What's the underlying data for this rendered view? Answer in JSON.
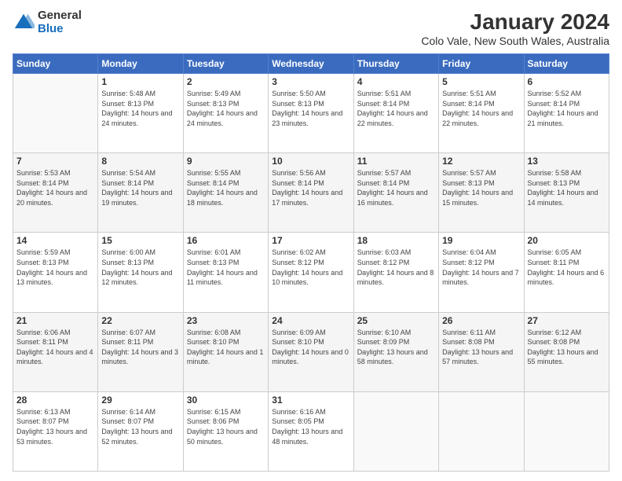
{
  "logo": {
    "general": "General",
    "blue": "Blue"
  },
  "title": "January 2024",
  "subtitle": "Colo Vale, New South Wales, Australia",
  "days_of_week": [
    "Sunday",
    "Monday",
    "Tuesday",
    "Wednesday",
    "Thursday",
    "Friday",
    "Saturday"
  ],
  "weeks": [
    [
      {
        "day": "",
        "empty": true
      },
      {
        "day": "1",
        "sunrise": "5:48 AM",
        "sunset": "8:13 PM",
        "daylight": "14 hours and 24 minutes."
      },
      {
        "day": "2",
        "sunrise": "5:49 AM",
        "sunset": "8:13 PM",
        "daylight": "14 hours and 24 minutes."
      },
      {
        "day": "3",
        "sunrise": "5:50 AM",
        "sunset": "8:13 PM",
        "daylight": "14 hours and 23 minutes."
      },
      {
        "day": "4",
        "sunrise": "5:51 AM",
        "sunset": "8:14 PM",
        "daylight": "14 hours and 22 minutes."
      },
      {
        "day": "5",
        "sunrise": "5:51 AM",
        "sunset": "8:14 PM",
        "daylight": "14 hours and 22 minutes."
      },
      {
        "day": "6",
        "sunrise": "5:52 AM",
        "sunset": "8:14 PM",
        "daylight": "14 hours and 21 minutes."
      }
    ],
    [
      {
        "day": "7",
        "sunrise": "5:53 AM",
        "sunset": "8:14 PM",
        "daylight": "14 hours and 20 minutes."
      },
      {
        "day": "8",
        "sunrise": "5:54 AM",
        "sunset": "8:14 PM",
        "daylight": "14 hours and 19 minutes."
      },
      {
        "day": "9",
        "sunrise": "5:55 AM",
        "sunset": "8:14 PM",
        "daylight": "14 hours and 18 minutes."
      },
      {
        "day": "10",
        "sunrise": "5:56 AM",
        "sunset": "8:14 PM",
        "daylight": "14 hours and 17 minutes."
      },
      {
        "day": "11",
        "sunrise": "5:57 AM",
        "sunset": "8:14 PM",
        "daylight": "14 hours and 16 minutes."
      },
      {
        "day": "12",
        "sunrise": "5:57 AM",
        "sunset": "8:13 PM",
        "daylight": "14 hours and 15 minutes."
      },
      {
        "day": "13",
        "sunrise": "5:58 AM",
        "sunset": "8:13 PM",
        "daylight": "14 hours and 14 minutes."
      }
    ],
    [
      {
        "day": "14",
        "sunrise": "5:59 AM",
        "sunset": "8:13 PM",
        "daylight": "14 hours and 13 minutes."
      },
      {
        "day": "15",
        "sunrise": "6:00 AM",
        "sunset": "8:13 PM",
        "daylight": "14 hours and 12 minutes."
      },
      {
        "day": "16",
        "sunrise": "6:01 AM",
        "sunset": "8:13 PM",
        "daylight": "14 hours and 11 minutes."
      },
      {
        "day": "17",
        "sunrise": "6:02 AM",
        "sunset": "8:12 PM",
        "daylight": "14 hours and 10 minutes."
      },
      {
        "day": "18",
        "sunrise": "6:03 AM",
        "sunset": "8:12 PM",
        "daylight": "14 hours and 8 minutes."
      },
      {
        "day": "19",
        "sunrise": "6:04 AM",
        "sunset": "8:12 PM",
        "daylight": "14 hours and 7 minutes."
      },
      {
        "day": "20",
        "sunrise": "6:05 AM",
        "sunset": "8:11 PM",
        "daylight": "14 hours and 6 minutes."
      }
    ],
    [
      {
        "day": "21",
        "sunrise": "6:06 AM",
        "sunset": "8:11 PM",
        "daylight": "14 hours and 4 minutes."
      },
      {
        "day": "22",
        "sunrise": "6:07 AM",
        "sunset": "8:11 PM",
        "daylight": "14 hours and 3 minutes."
      },
      {
        "day": "23",
        "sunrise": "6:08 AM",
        "sunset": "8:10 PM",
        "daylight": "14 hours and 1 minute."
      },
      {
        "day": "24",
        "sunrise": "6:09 AM",
        "sunset": "8:10 PM",
        "daylight": "14 hours and 0 minutes."
      },
      {
        "day": "25",
        "sunrise": "6:10 AM",
        "sunset": "8:09 PM",
        "daylight": "13 hours and 58 minutes."
      },
      {
        "day": "26",
        "sunrise": "6:11 AM",
        "sunset": "8:08 PM",
        "daylight": "13 hours and 57 minutes."
      },
      {
        "day": "27",
        "sunrise": "6:12 AM",
        "sunset": "8:08 PM",
        "daylight": "13 hours and 55 minutes."
      }
    ],
    [
      {
        "day": "28",
        "sunrise": "6:13 AM",
        "sunset": "8:07 PM",
        "daylight": "13 hours and 53 minutes."
      },
      {
        "day": "29",
        "sunrise": "6:14 AM",
        "sunset": "8:07 PM",
        "daylight": "13 hours and 52 minutes."
      },
      {
        "day": "30",
        "sunrise": "6:15 AM",
        "sunset": "8:06 PM",
        "daylight": "13 hours and 50 minutes."
      },
      {
        "day": "31",
        "sunrise": "6:16 AM",
        "sunset": "8:05 PM",
        "daylight": "13 hours and 48 minutes."
      },
      {
        "day": "",
        "empty": true
      },
      {
        "day": "",
        "empty": true
      },
      {
        "day": "",
        "empty": true
      }
    ]
  ]
}
